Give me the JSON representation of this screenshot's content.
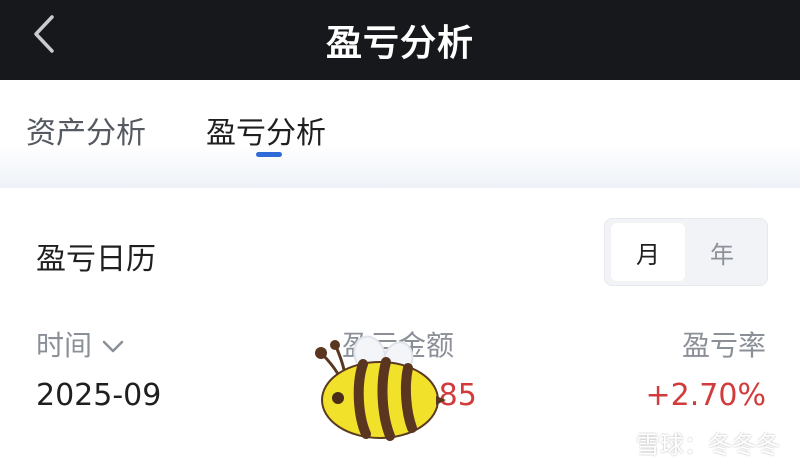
{
  "header": {
    "title": "盈亏分析"
  },
  "tabs": [
    {
      "label": "资产分析",
      "active": false
    },
    {
      "label": "盈亏分析",
      "active": true
    }
  ],
  "calendar": {
    "title": "盈亏日历",
    "period_toggle": {
      "month": "月",
      "year": "年",
      "selected": "月"
    }
  },
  "table": {
    "headers": {
      "time": "时间",
      "amount": "盈亏金额",
      "rate": "盈亏率"
    },
    "rows": [
      {
        "time": "2025-09",
        "amount": "1.85",
        "rate": "+2.70%"
      }
    ]
  },
  "watermark": {
    "text": "雪球：冬冬冬"
  },
  "colors": {
    "header_bg": "#17181c",
    "accent": "#2f6bd8",
    "gain": "#d13b3b"
  },
  "icons": [
    "chevron-left-icon",
    "chevron-down-icon",
    "bee-sticker",
    "snowball-logo-icon"
  ]
}
